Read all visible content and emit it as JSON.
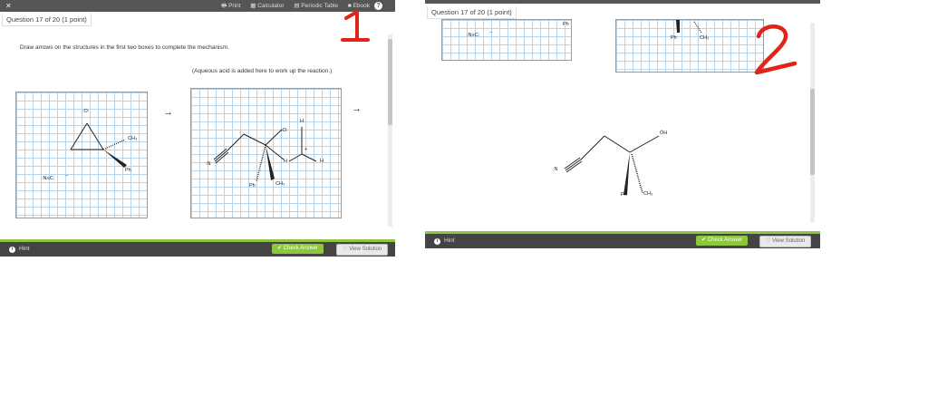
{
  "left": {
    "toolbar": {
      "print": "Print",
      "calculator": "Calculator",
      "periodic_table": "Periodic Table",
      "ebook": "Ebook",
      "help": "?"
    },
    "question_title": "Question 17 of 20 (1 point)",
    "instruction": "Draw arrows on the structures in the first two boxes to complete the mechanism.",
    "note": "(Aqueous acid is added here to work up the reaction.)",
    "box1": {
      "o": ":O:",
      "ch3": "CH₃",
      "ph": "Ph",
      "cyanide": ":N≡C:",
      "neg": "−"
    },
    "box2": {
      "n": ":N",
      "o": ":O:",
      "h_top": "H",
      "h_right": "H",
      "h_left": "H",
      "plus": "+",
      "ph": "Ph",
      "ch3": "CH₃"
    },
    "arrow": "→",
    "hint": "Hint",
    "check_answer": "Check Answer",
    "view_solution": "View Solution",
    "annotation": "1"
  },
  "right": {
    "question_title": "Question 17 of 20 (1 point)",
    "box_top_left": {
      "cyanide": ":N≡C:",
      "neg": "−",
      "ph": "Ph"
    },
    "box_top_right": {
      "ph": "Ph",
      "ch3": "CH₃"
    },
    "structure": {
      "n": ":N",
      "oh": "ÖH",
      "ph": "Ph",
      "ch3": "CH₃"
    },
    "hint": "Hint",
    "check_answer": "Check Answer",
    "view_solution": "View Solution",
    "annotation": "2"
  },
  "colors": {
    "accent_green": "#8dc63f",
    "annotation_red": "#e2231a",
    "grid": "#b9d3e8",
    "bar": "#444444"
  }
}
